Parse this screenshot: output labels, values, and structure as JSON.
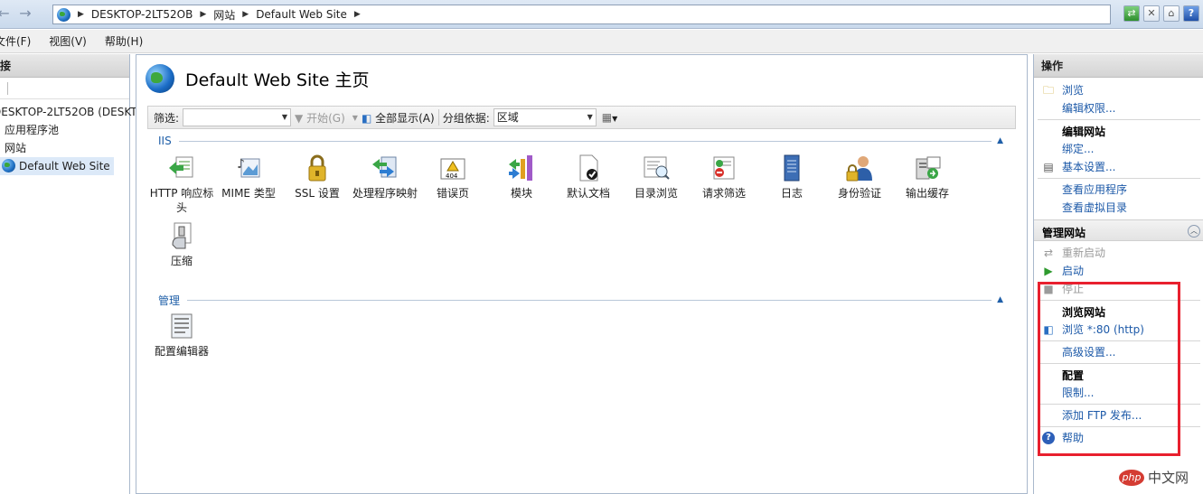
{
  "address_bar": {
    "crumbs": [
      "DESKTOP-2LT52OB",
      "网站",
      "Default Web Site"
    ]
  },
  "menu": {
    "file": "文件(F)",
    "view": "视图(V)",
    "help": "帮助(H)"
  },
  "left_panel": {
    "title": "连接",
    "tree": {
      "server": "DESKTOP-2LT52OB (DESKT",
      "app_pools": "应用程序池",
      "sites": "网站",
      "selected_site": "Default Web Site"
    }
  },
  "main": {
    "title": "Default Web Site 主页",
    "filter": {
      "label": "筛选:",
      "value": "",
      "start": "开始(G)",
      "show_all": "全部显示(A)",
      "group_by_label": "分组依据:",
      "group_by_value": "区域"
    },
    "groups": [
      {
        "name": "IIS",
        "features": [
          {
            "label": "HTTP 响应标头",
            "icon": "http-response-headers-icon"
          },
          {
            "label": "MIME 类型",
            "icon": "mime-types-icon"
          },
          {
            "label": "SSL 设置",
            "icon": "ssl-lock-icon"
          },
          {
            "label": "处理程序映射",
            "icon": "handler-mappings-icon"
          },
          {
            "label": "错误页",
            "icon": "error-pages-icon"
          },
          {
            "label": "模块",
            "icon": "modules-icon"
          },
          {
            "label": "默认文档",
            "icon": "default-document-icon"
          },
          {
            "label": "目录浏览",
            "icon": "directory-browsing-icon"
          },
          {
            "label": "请求筛选",
            "icon": "request-filtering-icon"
          },
          {
            "label": "日志",
            "icon": "logging-icon"
          },
          {
            "label": "身份验证",
            "icon": "authentication-icon"
          },
          {
            "label": "输出缓存",
            "icon": "output-caching-icon"
          },
          {
            "label": "压缩",
            "icon": "compression-icon"
          }
        ]
      },
      {
        "name": "管理",
        "features": [
          {
            "label": "配置编辑器",
            "icon": "configuration-editor-icon"
          }
        ]
      }
    ],
    "error_page_badge": "404"
  },
  "actions": {
    "title": "操作",
    "explore": "浏览",
    "edit_permissions": "编辑权限...",
    "edit_site_head": "编辑网站",
    "bindings": "绑定...",
    "basic_settings": "基本设置...",
    "view_apps": "查看应用程序",
    "view_vdirs": "查看虚拟目录",
    "manage_site_head": "管理网站",
    "restart": "重新启动",
    "start": "启动",
    "stop": "停止",
    "browse_site_head": "浏览网站",
    "browse_80": "浏览 *:80 (http)",
    "advanced_settings": "高级设置...",
    "config_head": "配置",
    "limits": "限制...",
    "add_ftp": "添加 FTP 发布...",
    "help": "帮助"
  },
  "watermark": {
    "badge": "php",
    "text": "中文网"
  },
  "colors": {
    "link": "#1c59a8",
    "group_title": "#1f5fa8",
    "highlight_box": "#e8202e",
    "selection": "#dce9f8"
  }
}
